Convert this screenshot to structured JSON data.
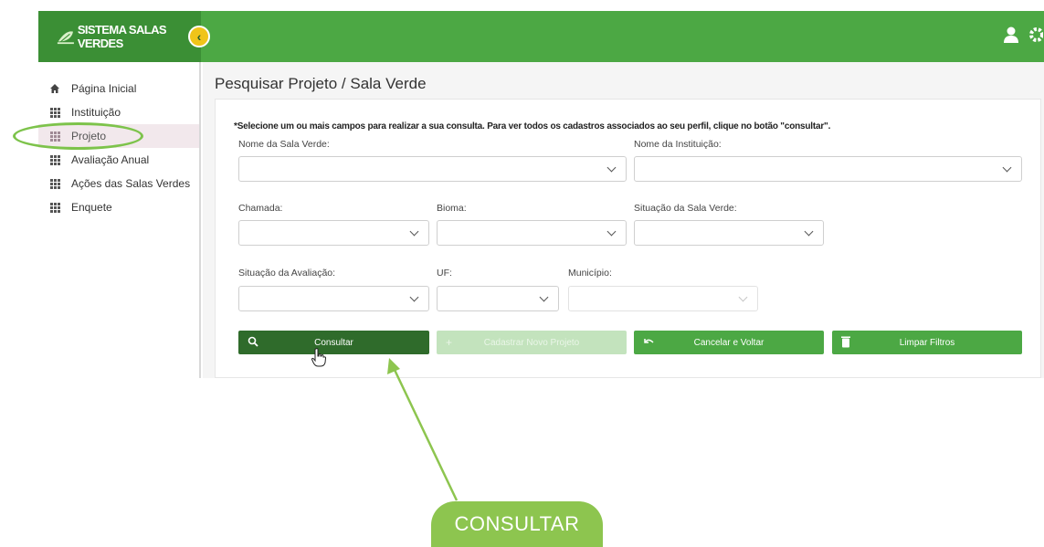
{
  "app": {
    "brand": "SISTEMA SALAS VERDES"
  },
  "sidebar": {
    "items": [
      {
        "label": "Página Inicial",
        "icon": "home-icon"
      },
      {
        "label": "Instituição",
        "icon": "grid-icon"
      },
      {
        "label": "Projeto",
        "icon": "grid-icon",
        "active": true
      },
      {
        "label": "Avaliação Anual",
        "icon": "grid-icon"
      },
      {
        "label": "Ações das Salas Verdes",
        "icon": "grid-icon"
      },
      {
        "label": "Enquete",
        "icon": "grid-icon"
      }
    ]
  },
  "main": {
    "title": "Pesquisar Projeto / Sala Verde",
    "instructions": "*Selecione um ou mais campos para realizar a sua consulta. Para ver todos os cadastros associados ao seu perfil, clique no botão \"consultar\".",
    "fields": {
      "nome_sala_verde": "Nome da Sala Verde:",
      "nome_instituicao": "Nome da Instituição:",
      "chamada": "Chamada:",
      "bioma": "Bioma:",
      "situacao_sala_verde": "Situação da Sala Verde:",
      "situacao_avaliacao": "Situação da Avaliação:",
      "uf": "UF:",
      "municipio": "Município:"
    },
    "buttons": {
      "consultar": "Consultar",
      "cadastrar": "Cadastrar Novo Projeto",
      "cancelar": "Cancelar e Voltar",
      "limpar": "Limpar Filtros"
    }
  },
  "annotation": {
    "label": "CONSULTAR"
  },
  "colors": {
    "brand_green": "#4ca844",
    "dark_green": "#2f6b2b",
    "highlight_green": "#8dc54f",
    "accent_yellow": "#f0c419"
  }
}
